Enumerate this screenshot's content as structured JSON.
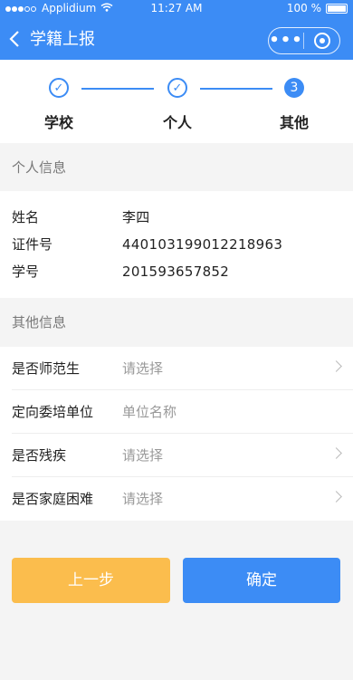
{
  "status_bar": {
    "carrier": "Applidium",
    "time": "11:27 AM",
    "battery": "100 %"
  },
  "nav": {
    "title": "学籍上报",
    "more_label": "•••"
  },
  "steps": [
    {
      "label": "学校",
      "marker": "✓"
    },
    {
      "label": "个人",
      "marker": "✓"
    },
    {
      "label": "其他",
      "marker": "3"
    }
  ],
  "personal": {
    "title": "个人信息",
    "rows": [
      {
        "label": "姓名",
        "value": "李四"
      },
      {
        "label": "证件号",
        "value": "440103199012218963"
      },
      {
        "label": "学号",
        "value": "201593657852"
      }
    ]
  },
  "other": {
    "title": "其他信息",
    "rows": [
      {
        "label": "是否师范生",
        "value": "请选择"
      },
      {
        "label": "定向委培单位",
        "value": "单位名称"
      },
      {
        "label": "是否残疾",
        "value": "请选择"
      },
      {
        "label": "是否家庭困难",
        "value": "请选择"
      }
    ]
  },
  "buttons": {
    "prev": "上一步",
    "confirm": "确定"
  },
  "colors": {
    "primary": "#3c8cf5",
    "secondary": "#fbbd4d"
  }
}
